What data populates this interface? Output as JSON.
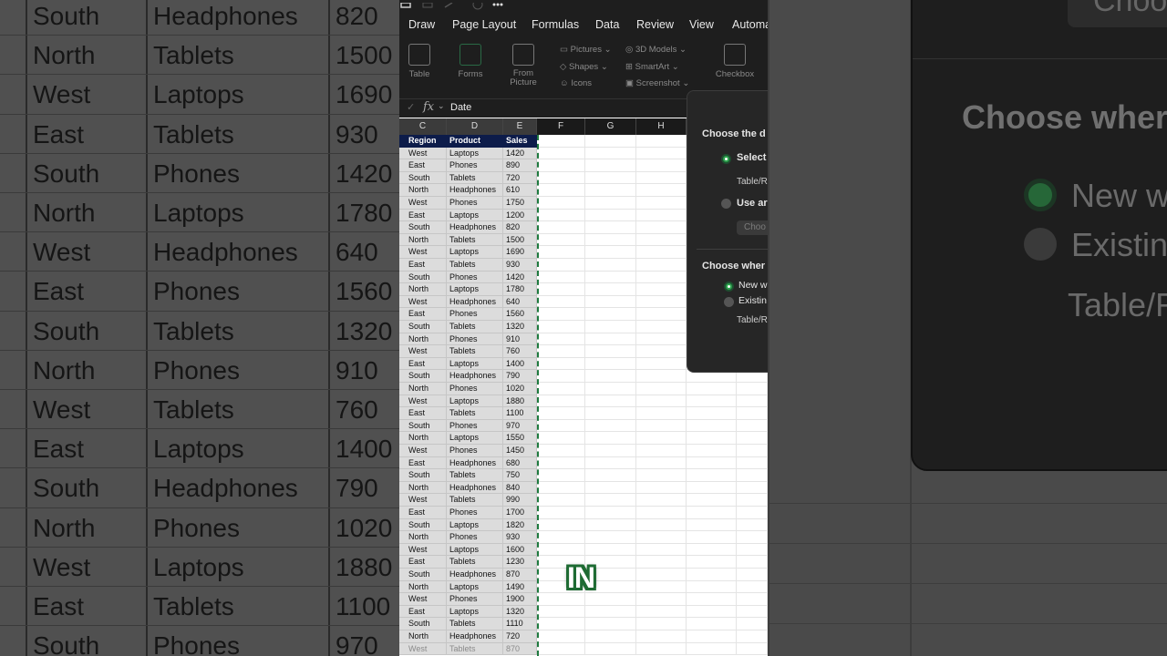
{
  "ribbon": {
    "tabs": [
      "Draw",
      "Page Layout",
      "Formulas",
      "Data",
      "Review",
      "View",
      "Automa"
    ],
    "buttons": {
      "table": "Table",
      "forms": "Forms",
      "from_picture": "From Picture",
      "pictures": "Pictures",
      "shapes": "Shapes",
      "icons": "Icons",
      "models_3d": "3D Models",
      "smartart": "SmartArt",
      "screenshot": "Screenshot",
      "checkbox": "Checkbox"
    }
  },
  "formula_bar": {
    "fx": "fx",
    "value": "Date"
  },
  "columns": [
    "C",
    "D",
    "E",
    "F",
    "G",
    "H"
  ],
  "table": {
    "headers": [
      "Region",
      "Product",
      "Sales"
    ],
    "rows": [
      [
        "West",
        "Laptops",
        "1420"
      ],
      [
        "East",
        "Phones",
        "890"
      ],
      [
        "South",
        "Tablets",
        "720"
      ],
      [
        "North",
        "Headphones",
        "610"
      ],
      [
        "West",
        "Phones",
        "1750"
      ],
      [
        "East",
        "Laptops",
        "1200"
      ],
      [
        "South",
        "Headphones",
        "820"
      ],
      [
        "North",
        "Tablets",
        "1500"
      ],
      [
        "West",
        "Laptops",
        "1690"
      ],
      [
        "East",
        "Tablets",
        "930"
      ],
      [
        "South",
        "Phones",
        "1420"
      ],
      [
        "North",
        "Laptops",
        "1780"
      ],
      [
        "West",
        "Headphones",
        "640"
      ],
      [
        "East",
        "Phones",
        "1560"
      ],
      [
        "South",
        "Tablets",
        "1320"
      ],
      [
        "North",
        "Phones",
        "910"
      ],
      [
        "West",
        "Tablets",
        "760"
      ],
      [
        "East",
        "Laptops",
        "1400"
      ],
      [
        "South",
        "Headphones",
        "790"
      ],
      [
        "North",
        "Phones",
        "1020"
      ],
      [
        "West",
        "Laptops",
        "1880"
      ],
      [
        "East",
        "Tablets",
        "1100"
      ],
      [
        "South",
        "Phones",
        "970"
      ],
      [
        "North",
        "Laptops",
        "1550"
      ],
      [
        "West",
        "Phones",
        "1450"
      ],
      [
        "East",
        "Headphones",
        "680"
      ],
      [
        "South",
        "Tablets",
        "750"
      ],
      [
        "North",
        "Headphones",
        "840"
      ],
      [
        "West",
        "Tablets",
        "990"
      ],
      [
        "East",
        "Phones",
        "1700"
      ],
      [
        "South",
        "Laptops",
        "1820"
      ],
      [
        "North",
        "Phones",
        "930"
      ],
      [
        "West",
        "Laptops",
        "1600"
      ],
      [
        "East",
        "Tablets",
        "1230"
      ],
      [
        "South",
        "Headphones",
        "870"
      ],
      [
        "North",
        "Laptops",
        "1490"
      ],
      [
        "West",
        "Phones",
        "1900"
      ],
      [
        "East",
        "Laptops",
        "1320"
      ],
      [
        "South",
        "Tablets",
        "1110"
      ],
      [
        "North",
        "Headphones",
        "720"
      ],
      [
        "West",
        "Tablets",
        "870"
      ]
    ]
  },
  "zoom_left_rows": [
    [
      "South",
      "Headphones",
      "820"
    ],
    [
      "North",
      "Tablets",
      "1500"
    ],
    [
      "West",
      "Laptops",
      "1690"
    ],
    [
      "East",
      "Tablets",
      "930"
    ],
    [
      "South",
      "Phones",
      "1420"
    ],
    [
      "North",
      "Laptops",
      "1780"
    ],
    [
      "West",
      "Headphones",
      "640"
    ],
    [
      "East",
      "Phones",
      "1560"
    ],
    [
      "South",
      "Tablets",
      "1320"
    ],
    [
      "North",
      "Phones",
      "910"
    ],
    [
      "West",
      "Tablets",
      "760"
    ],
    [
      "East",
      "Laptops",
      "1400"
    ],
    [
      "South",
      "Headphones",
      "790"
    ],
    [
      "North",
      "Phones",
      "1020"
    ],
    [
      "West",
      "Laptops",
      "1880"
    ],
    [
      "East",
      "Tablets",
      "1100"
    ],
    [
      "South",
      "Phones",
      "970"
    ]
  ],
  "dialog": {
    "title1": "Choose the d",
    "option_select": "Select",
    "table_range_label": "Table/R",
    "option_use": "Use ar",
    "choose_button": "Choo",
    "title2": "Choose wher",
    "option_new": "New w",
    "option_existing": "Existin",
    "table_range_label2": "Table/R"
  },
  "zoom_right": {
    "button": "Choo",
    "title": "Choose wher",
    "option_new": "New w",
    "option_existing": "Existin",
    "table_range": "Table/R"
  },
  "caption": "IN",
  "colors": {
    "header_fill": "#0d1c4a",
    "accent_green": "#2da44e",
    "selection_border": "#1f7a3f"
  }
}
